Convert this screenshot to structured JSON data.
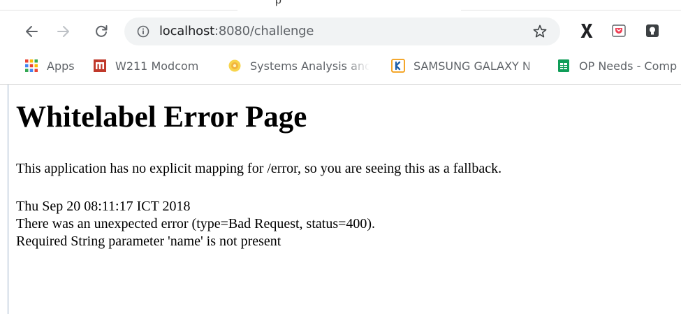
{
  "tab_strip": {
    "partial_tab_text": "p"
  },
  "toolbar": {
    "url": {
      "host": "localhost",
      "path": ":8080/challenge"
    }
  },
  "bookmarks": [
    {
      "label": "Apps",
      "icon": "apps-grid-icon"
    },
    {
      "label": "W211 Modcom",
      "icon": "modcom-logo-icon"
    },
    {
      "label": "Systems Analysis and",
      "icon": "systems-analysis-icon"
    },
    {
      "label": "SAMSUNG GALAXY N",
      "icon": "samsung-bookmark-icon"
    },
    {
      "label": "OP Needs - Comp",
      "icon": "google-sheets-icon"
    }
  ],
  "page": {
    "title": "Whitelabel Error Page",
    "intro": "This application has no explicit mapping for /error, so you are seeing this as a fallback.",
    "timestamp": "Thu Sep 20 08:11:17 ICT 2018",
    "error_type": "There was an unexpected error (type=Bad Request, status=400).",
    "error_detail": "Required String parameter 'name' is not present"
  },
  "colors": {
    "omnibox_bg": "#f1f3f4",
    "toolbar_icon": "#5f6368",
    "sheets_green": "#0f9d58",
    "modcom_red": "#c0392b",
    "samsung_orange": "#f39c12",
    "pocket_red": "#ef4056"
  }
}
